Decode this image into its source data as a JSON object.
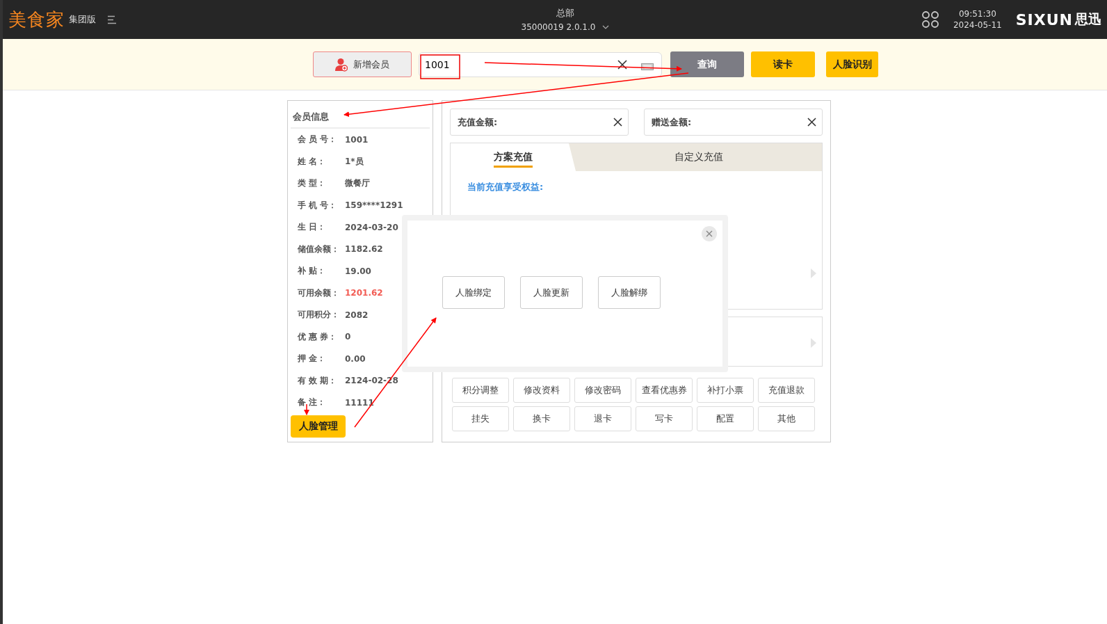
{
  "header": {
    "logo": "美食家",
    "edition": "集团版",
    "store": "总部",
    "version": "35000019  2.0.1.0",
    "time": "09:51:30",
    "date": "2024-05-11",
    "brand": "SIXUN",
    "brand_cn": "思迅"
  },
  "toolbar": {
    "add_member": "新增会员",
    "search": {
      "value": "1001"
    },
    "buttons": [
      {
        "label": "查询",
        "kind": "gray"
      },
      {
        "label": "读卡",
        "kind": "yellow"
      },
      {
        "label": "人脸识别",
        "kind": "yellow"
      }
    ]
  },
  "member_info": {
    "title": "会员信息",
    "fields": [
      {
        "label": "会 员 号：",
        "value": "1001",
        "highlight": false
      },
      {
        "label": "姓 名：",
        "value": "1*员",
        "highlight": false
      },
      {
        "label": "类 型：",
        "value": "微餐厅",
        "highlight": false
      },
      {
        "label": "手 机 号：",
        "value": "159****1291",
        "highlight": false
      },
      {
        "label": "生 日：",
        "value": "2024-03-20",
        "highlight": false
      },
      {
        "label": "储值余额：",
        "value": "1182.62",
        "highlight": false
      },
      {
        "label": "补 贴：",
        "value": "19.00",
        "highlight": false
      },
      {
        "label": "可用余额：",
        "value": "1201.62",
        "highlight": true
      },
      {
        "label": "可用积分：",
        "value": "2082",
        "highlight": false
      },
      {
        "label": "优 惠 券：",
        "value": "0",
        "highlight": false
      },
      {
        "label": "押 金：",
        "value": "0.00",
        "highlight": false
      },
      {
        "label": "有 效 期：",
        "value": "2124-02-28",
        "highlight": false
      },
      {
        "label": "备 注：",
        "value": "11111",
        "highlight": false
      }
    ],
    "face_button": "人脸管理"
  },
  "recharge": {
    "fields": [
      {
        "label": "充值金额:"
      },
      {
        "label": "赠送金额:"
      }
    ],
    "tabs": [
      {
        "label": "方案充值",
        "selected": true
      },
      {
        "label": "自定义充值",
        "selected": false
      }
    ],
    "benefits_label": "当前充值享受权益:",
    "actions": [
      [
        "积分调整",
        "修改资料",
        "修改密码",
        "查看优惠券",
        "补打小票",
        "充值退款"
      ],
      [
        "挂失",
        "换卡",
        "退卡",
        "写卡",
        "配置",
        "其他"
      ]
    ]
  },
  "modal": {
    "buttons": [
      "人脸绑定",
      "人脸更新",
      "人脸解绑"
    ]
  }
}
